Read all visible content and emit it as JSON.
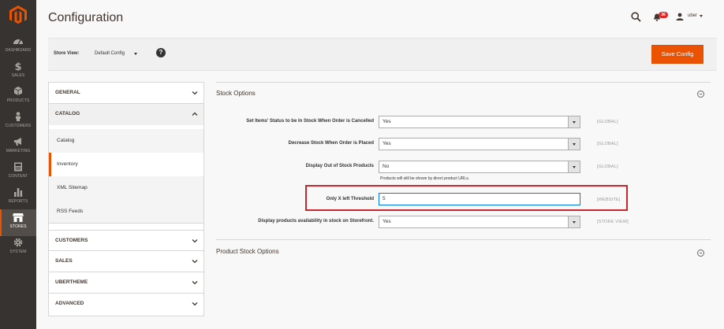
{
  "header": {
    "title": "Configuration",
    "notification_count": "36",
    "user_name": "uber"
  },
  "nav": {
    "items": [
      {
        "label": "DASHBOARD",
        "icon": "dashboard-icon"
      },
      {
        "label": "SALES",
        "icon": "dollar-icon"
      },
      {
        "label": "PRODUCTS",
        "icon": "cube-icon"
      },
      {
        "label": "CUSTOMERS",
        "icon": "person-icon"
      },
      {
        "label": "MARKETING",
        "icon": "megaphone-icon"
      },
      {
        "label": "CONTENT",
        "icon": "content-icon"
      },
      {
        "label": "REPORTS",
        "icon": "bar-chart-icon"
      },
      {
        "label": "STORES",
        "icon": "store-icon"
      },
      {
        "label": "SYSTEM",
        "icon": "gear-icon"
      }
    ],
    "active": "STORES"
  },
  "store_bar": {
    "label": "Store View:",
    "value": "Default Config",
    "help": "?",
    "save_label": "Save Config"
  },
  "tabs": {
    "general": "GENERAL",
    "catalog": "CATALOG",
    "catalog_items": [
      "Catalog",
      "Inventory",
      "XML Sitemap",
      "RSS Feeds"
    ],
    "active_item": "Inventory",
    "customers": "CUSTOMERS",
    "sales": "SALES",
    "ubertheme": "UBERTHEME",
    "advanced": "ADVANCED"
  },
  "stock_options": {
    "title": "Stock Options",
    "rows": [
      {
        "label": "Set Items' Status to be In Stock When Order is Cancelled",
        "value": "Yes",
        "scope": "[GLOBAL]"
      },
      {
        "label": "Decrease Stock When Order is Placed",
        "value": "Yes",
        "scope": "[GLOBAL]"
      },
      {
        "label": "Display Out of Stock Products",
        "value": "No",
        "scope": "[GLOBAL]",
        "note": "Products will still be shown by direct product URLs."
      },
      {
        "label": "Only X left Threshold",
        "value": "5",
        "scope": "[WEBSITE]"
      },
      {
        "label": "Display products availability in stock on Storefront.",
        "value": "Yes",
        "scope": "[STORE VIEW]"
      }
    ]
  },
  "product_stock_options": {
    "title": "Product Stock Options"
  },
  "colors": {
    "accent": "#eb5202",
    "nav_bg": "#373330",
    "highlight": "#c8282d"
  }
}
